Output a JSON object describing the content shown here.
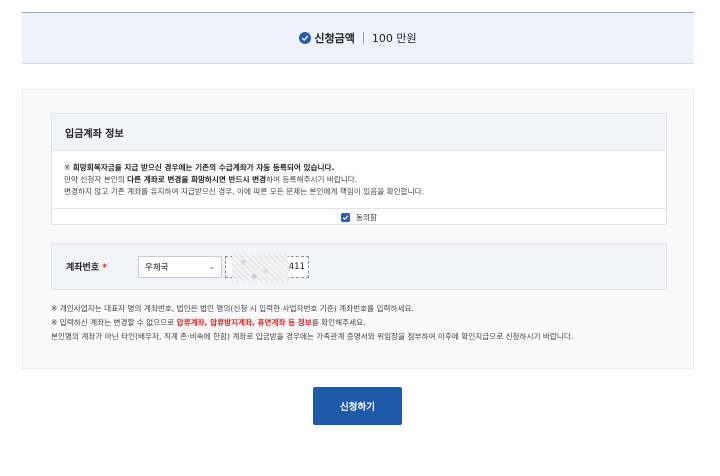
{
  "summary": {
    "label": "신청금액",
    "value": "100 만원"
  },
  "account_info": {
    "title": "입금계좌 정보",
    "notice_lines": [
      {
        "pre": "※ ",
        "bold": "희망회복자금을 지급 받으신 경우에는 기존의 수급계좌가 자동 등록되어 있습니다.",
        "post": ""
      },
      {
        "pre": "만약 신청자 본인의 ",
        "bold": "다른 계좌로 변경을 희망하시면 반드시 변경",
        "post": "하여 등록해주시기 바랍니다."
      },
      {
        "pre": "변경하지 않고 기존 계좌를 유지하여 지급받으신 경우, 이에 따른 모든 문제는 본인에게 책임이 있음을 확인합니다.",
        "bold": "",
        "post": ""
      }
    ],
    "agree_label": "동의함",
    "agree_checked": true
  },
  "account_number": {
    "label": "계좌번호",
    "required_mark": "*",
    "bank_selected": "우체국",
    "account_value_visible": "411"
  },
  "footnotes": {
    "line1": "※ 개인사업자는 대표자 명의 계좌번호, 법인은 법인 명의(신청 시 입력한 사업자번호 기준) 계좌번호를 입력하세요.",
    "line2_pre": "※ 입력하신 계좌는 변경할 수 없으므로 ",
    "line2_red": "압류계좌, 압류방지계좌, 휴면계좌 등 정보",
    "line2_post": "를 확인해주세요.",
    "line3": "본인명의 계좌가 아닌 타인(배우자, 직계 존·비속에 한함) 계좌로 입금받을 경우에는 가족관계 증명서와 위임장을 첨부하여 이후에 확인지급으로 신청하시기 바랍니다."
  },
  "submit_label": "신청하기",
  "colors": {
    "accent": "#1e5aa8",
    "warning": "#e02020",
    "summary_bg": "#eef3fb"
  }
}
